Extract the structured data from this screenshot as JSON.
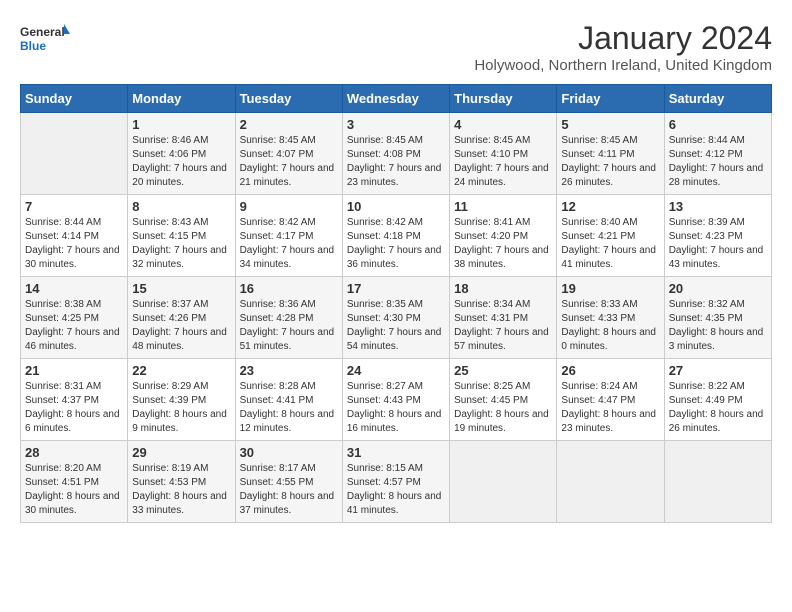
{
  "header": {
    "logo_line1": "General",
    "logo_line2": "Blue",
    "main_title": "January 2024",
    "subtitle": "Holywood, Northern Ireland, United Kingdom"
  },
  "days_of_week": [
    "Sunday",
    "Monday",
    "Tuesday",
    "Wednesday",
    "Thursday",
    "Friday",
    "Saturday"
  ],
  "weeks": [
    [
      {
        "day": "",
        "sunrise": "",
        "sunset": "",
        "daylight": ""
      },
      {
        "day": "1",
        "sunrise": "Sunrise: 8:46 AM",
        "sunset": "Sunset: 4:06 PM",
        "daylight": "Daylight: 7 hours and 20 minutes."
      },
      {
        "day": "2",
        "sunrise": "Sunrise: 8:45 AM",
        "sunset": "Sunset: 4:07 PM",
        "daylight": "Daylight: 7 hours and 21 minutes."
      },
      {
        "day": "3",
        "sunrise": "Sunrise: 8:45 AM",
        "sunset": "Sunset: 4:08 PM",
        "daylight": "Daylight: 7 hours and 23 minutes."
      },
      {
        "day": "4",
        "sunrise": "Sunrise: 8:45 AM",
        "sunset": "Sunset: 4:10 PM",
        "daylight": "Daylight: 7 hours and 24 minutes."
      },
      {
        "day": "5",
        "sunrise": "Sunrise: 8:45 AM",
        "sunset": "Sunset: 4:11 PM",
        "daylight": "Daylight: 7 hours and 26 minutes."
      },
      {
        "day": "6",
        "sunrise": "Sunrise: 8:44 AM",
        "sunset": "Sunset: 4:12 PM",
        "daylight": "Daylight: 7 hours and 28 minutes."
      }
    ],
    [
      {
        "day": "7",
        "sunrise": "Sunrise: 8:44 AM",
        "sunset": "Sunset: 4:14 PM",
        "daylight": "Daylight: 7 hours and 30 minutes."
      },
      {
        "day": "8",
        "sunrise": "Sunrise: 8:43 AM",
        "sunset": "Sunset: 4:15 PM",
        "daylight": "Daylight: 7 hours and 32 minutes."
      },
      {
        "day": "9",
        "sunrise": "Sunrise: 8:42 AM",
        "sunset": "Sunset: 4:17 PM",
        "daylight": "Daylight: 7 hours and 34 minutes."
      },
      {
        "day": "10",
        "sunrise": "Sunrise: 8:42 AM",
        "sunset": "Sunset: 4:18 PM",
        "daylight": "Daylight: 7 hours and 36 minutes."
      },
      {
        "day": "11",
        "sunrise": "Sunrise: 8:41 AM",
        "sunset": "Sunset: 4:20 PM",
        "daylight": "Daylight: 7 hours and 38 minutes."
      },
      {
        "day": "12",
        "sunrise": "Sunrise: 8:40 AM",
        "sunset": "Sunset: 4:21 PM",
        "daylight": "Daylight: 7 hours and 41 minutes."
      },
      {
        "day": "13",
        "sunrise": "Sunrise: 8:39 AM",
        "sunset": "Sunset: 4:23 PM",
        "daylight": "Daylight: 7 hours and 43 minutes."
      }
    ],
    [
      {
        "day": "14",
        "sunrise": "Sunrise: 8:38 AM",
        "sunset": "Sunset: 4:25 PM",
        "daylight": "Daylight: 7 hours and 46 minutes."
      },
      {
        "day": "15",
        "sunrise": "Sunrise: 8:37 AM",
        "sunset": "Sunset: 4:26 PM",
        "daylight": "Daylight: 7 hours and 48 minutes."
      },
      {
        "day": "16",
        "sunrise": "Sunrise: 8:36 AM",
        "sunset": "Sunset: 4:28 PM",
        "daylight": "Daylight: 7 hours and 51 minutes."
      },
      {
        "day": "17",
        "sunrise": "Sunrise: 8:35 AM",
        "sunset": "Sunset: 4:30 PM",
        "daylight": "Daylight: 7 hours and 54 minutes."
      },
      {
        "day": "18",
        "sunrise": "Sunrise: 8:34 AM",
        "sunset": "Sunset: 4:31 PM",
        "daylight": "Daylight: 7 hours and 57 minutes."
      },
      {
        "day": "19",
        "sunrise": "Sunrise: 8:33 AM",
        "sunset": "Sunset: 4:33 PM",
        "daylight": "Daylight: 8 hours and 0 minutes."
      },
      {
        "day": "20",
        "sunrise": "Sunrise: 8:32 AM",
        "sunset": "Sunset: 4:35 PM",
        "daylight": "Daylight: 8 hours and 3 minutes."
      }
    ],
    [
      {
        "day": "21",
        "sunrise": "Sunrise: 8:31 AM",
        "sunset": "Sunset: 4:37 PM",
        "daylight": "Daylight: 8 hours and 6 minutes."
      },
      {
        "day": "22",
        "sunrise": "Sunrise: 8:29 AM",
        "sunset": "Sunset: 4:39 PM",
        "daylight": "Daylight: 8 hours and 9 minutes."
      },
      {
        "day": "23",
        "sunrise": "Sunrise: 8:28 AM",
        "sunset": "Sunset: 4:41 PM",
        "daylight": "Daylight: 8 hours and 12 minutes."
      },
      {
        "day": "24",
        "sunrise": "Sunrise: 8:27 AM",
        "sunset": "Sunset: 4:43 PM",
        "daylight": "Daylight: 8 hours and 16 minutes."
      },
      {
        "day": "25",
        "sunrise": "Sunrise: 8:25 AM",
        "sunset": "Sunset: 4:45 PM",
        "daylight": "Daylight: 8 hours and 19 minutes."
      },
      {
        "day": "26",
        "sunrise": "Sunrise: 8:24 AM",
        "sunset": "Sunset: 4:47 PM",
        "daylight": "Daylight: 8 hours and 23 minutes."
      },
      {
        "day": "27",
        "sunrise": "Sunrise: 8:22 AM",
        "sunset": "Sunset: 4:49 PM",
        "daylight": "Daylight: 8 hours and 26 minutes."
      }
    ],
    [
      {
        "day": "28",
        "sunrise": "Sunrise: 8:20 AM",
        "sunset": "Sunset: 4:51 PM",
        "daylight": "Daylight: 8 hours and 30 minutes."
      },
      {
        "day": "29",
        "sunrise": "Sunrise: 8:19 AM",
        "sunset": "Sunset: 4:53 PM",
        "daylight": "Daylight: 8 hours and 33 minutes."
      },
      {
        "day": "30",
        "sunrise": "Sunrise: 8:17 AM",
        "sunset": "Sunset: 4:55 PM",
        "daylight": "Daylight: 8 hours and 37 minutes."
      },
      {
        "day": "31",
        "sunrise": "Sunrise: 8:15 AM",
        "sunset": "Sunset: 4:57 PM",
        "daylight": "Daylight: 8 hours and 41 minutes."
      },
      {
        "day": "",
        "sunrise": "",
        "sunset": "",
        "daylight": ""
      },
      {
        "day": "",
        "sunrise": "",
        "sunset": "",
        "daylight": ""
      },
      {
        "day": "",
        "sunrise": "",
        "sunset": "",
        "daylight": ""
      }
    ]
  ]
}
